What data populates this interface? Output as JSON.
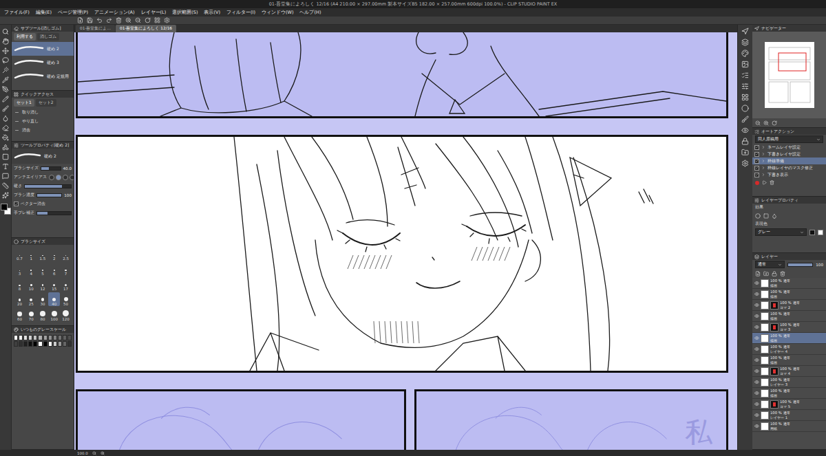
{
  "window": {
    "title": "01-吾堂集によろしく 12/16 (A4 210.00 × 297.00mm 製本サイズB5 182.00 × 257.00mm 600dpi 100.0%) - CLIP STUDIO PAINT EX"
  },
  "menu": [
    "ファイル(F)",
    "編集(E)",
    "ページ管理(P)",
    "アニメーション(A)",
    "レイヤー(L)",
    "選択範囲(S)",
    "表示(V)",
    "フィルター(I)",
    "ウィンドウ(W)",
    "ヘルプ(H)"
  ],
  "doc_tabs": [
    {
      "label": "01-吾堂集によ...",
      "selected": false
    },
    {
      "label": "01-吾堂集によろしく 12/16",
      "selected": true
    }
  ],
  "subtool": {
    "title": "サブツール[消しゴム]",
    "tabs": [
      {
        "label": "利用する",
        "selected": true
      },
      {
        "label": "消しゴム",
        "selected": false
      }
    ],
    "items": [
      {
        "label": "硬め 2",
        "selected": true
      },
      {
        "label": "硬め 3",
        "selected": false
      },
      {
        "label": "硬め 定規用",
        "selected": false
      }
    ]
  },
  "quick_access": {
    "title": "クイックアクセス",
    "tabs": [
      {
        "label": "セット1",
        "selected": true
      },
      {
        "label": "セット2",
        "selected": false
      }
    ],
    "items": [
      "取り消し",
      "やり直し",
      "消去"
    ]
  },
  "tool_property": {
    "title": "ツールプロパティ[硬め 2]",
    "preview": "硬め 2",
    "rows": [
      {
        "kind": "slider",
        "label": "ブラシサイズ",
        "value": "40.0",
        "level": 0.4
      },
      {
        "kind": "aa",
        "label": "アンチエイリアス",
        "options": [
          {
            "selected": false
          },
          {
            "selected": true
          },
          {
            "selected": false
          },
          {
            "selected": false
          }
        ]
      },
      {
        "kind": "slider",
        "label": "硬さ",
        "level": 0.8
      },
      {
        "kind": "slider",
        "label": "ブラシ濃度",
        "value": "100",
        "level": 1
      },
      {
        "kind": "check",
        "label": "ベクター消去",
        "checked": true
      },
      {
        "kind": "slider",
        "label": "手ブレ補正",
        "level": 0.3
      }
    ]
  },
  "brush_size": {
    "title": "ブラシサイズ",
    "sizes": [
      {
        "label": "0.7",
        "selected": false
      },
      {
        "label": "1",
        "selected": false
      },
      {
        "label": "1.5",
        "selected": false
      },
      {
        "label": "2",
        "selected": false
      },
      {
        "label": "2.5",
        "selected": false
      },
      {
        "label": "3",
        "selected": false
      },
      {
        "label": "4",
        "selected": false
      },
      {
        "label": "5",
        "selected": false
      },
      {
        "label": "6",
        "selected": false
      },
      {
        "label": "7",
        "selected": false
      },
      {
        "label": "8",
        "selected": false
      },
      {
        "label": "10",
        "selected": false
      },
      {
        "label": "12",
        "selected": false
      },
      {
        "label": "15",
        "selected": false
      },
      {
        "label": "17",
        "selected": false
      },
      {
        "label": "20",
        "selected": false
      },
      {
        "label": "25",
        "selected": false
      },
      {
        "label": "30",
        "selected": false
      },
      {
        "label": "40",
        "selected": true
      },
      {
        "label": "50",
        "selected": false
      },
      {
        "label": "60",
        "selected": false
      },
      {
        "label": "70",
        "selected": false
      },
      {
        "label": "80",
        "selected": false
      },
      {
        "label": "100",
        "selected": false
      },
      {
        "label": "120",
        "selected": false
      }
    ]
  },
  "color_set": {
    "title": "いつものグレースケール",
    "colors": [
      "#ffffff",
      "#f0f0f0",
      "#e0e0e0",
      "#d0d0d0",
      "#c0c0c0",
      "#b0b0b0",
      "#a0a0a0",
      "#909090",
      "#808080",
      "#707070",
      "#606060",
      "#505050",
      "#404040",
      "#303030",
      "#202020",
      "#101010",
      "#000000",
      "#ffffff",
      "#000000",
      "#ffffff",
      "#cccccc",
      "#999999",
      "#666666",
      "#333333"
    ]
  },
  "colors": {
    "main": "#000000",
    "sub": "#ffffff"
  },
  "navigator": {
    "title": "ナビゲーター"
  },
  "auto_action": {
    "title": "オートアクション",
    "set": "同人原稿用",
    "items": [
      {
        "label": "ネームレイヤ設定",
        "checked": true,
        "selected": false
      },
      {
        "label": "下書きレイヤ設定",
        "checked": true,
        "selected": false
      },
      {
        "label": "枠線準備",
        "checked": true,
        "selected": true
      },
      {
        "label": "枠線レイヤのマスク修正",
        "checked": true,
        "selected": false
      },
      {
        "label": "下書き表示",
        "checked": true,
        "selected": false
      }
    ]
  },
  "layer_property": {
    "title": "レイヤープロパティ",
    "effect": "効果",
    "color_label": "表現色",
    "color_mode": "グレー"
  },
  "layers": {
    "title": "レイヤー",
    "blend": "通常",
    "opacity": "100",
    "rows": [
      {
        "opacity": "100 % 通常",
        "name": "描画",
        "kind": "raster",
        "visible": true,
        "selected": false
      },
      {
        "opacity": "100 % 通常",
        "name": "描画",
        "kind": "raster",
        "visible": true,
        "selected": false
      },
      {
        "opacity": "100 % 通常",
        "name": "コマ 2",
        "kind": "frame",
        "visible": true,
        "selected": false
      },
      {
        "opacity": "100 % 通常",
        "name": "描画",
        "kind": "raster",
        "visible": true,
        "selected": false
      },
      {
        "opacity": "100 % 通常",
        "name": "コマ 3",
        "kind": "frame",
        "visible": true,
        "selected": false
      },
      {
        "opacity": "100 % 通常",
        "name": "描画",
        "kind": "raster",
        "visible": true,
        "selected": true
      },
      {
        "opacity": "100 % 通常",
        "name": "レイヤー 4",
        "kind": "raster",
        "visible": true,
        "selected": false
      },
      {
        "opacity": "100 % 通常",
        "name": "描画",
        "kind": "raster",
        "visible": true,
        "selected": false
      },
      {
        "opacity": "100 % 通常",
        "name": "コマ 4",
        "kind": "frame",
        "visible": true,
        "selected": false
      },
      {
        "opacity": "100 % 通常",
        "name": "レイヤー 3",
        "kind": "raster",
        "visible": true,
        "selected": false
      },
      {
        "opacity": "100 % 通常",
        "name": "描画",
        "kind": "raster",
        "visible": true,
        "selected": false
      },
      {
        "opacity": "100 % 通常",
        "name": "コマ 5",
        "kind": "frame",
        "visible": true,
        "selected": false
      },
      {
        "opacity": "100 % 通常",
        "name": "レイヤー 1",
        "kind": "raster",
        "visible": true,
        "selected": false
      },
      {
        "opacity": "100 % 通常",
        "name": "用紙",
        "kind": "paper",
        "visible": true,
        "selected": false
      }
    ]
  },
  "canvas": {
    "note": "私"
  },
  "status": {
    "zoom": "100.0"
  }
}
